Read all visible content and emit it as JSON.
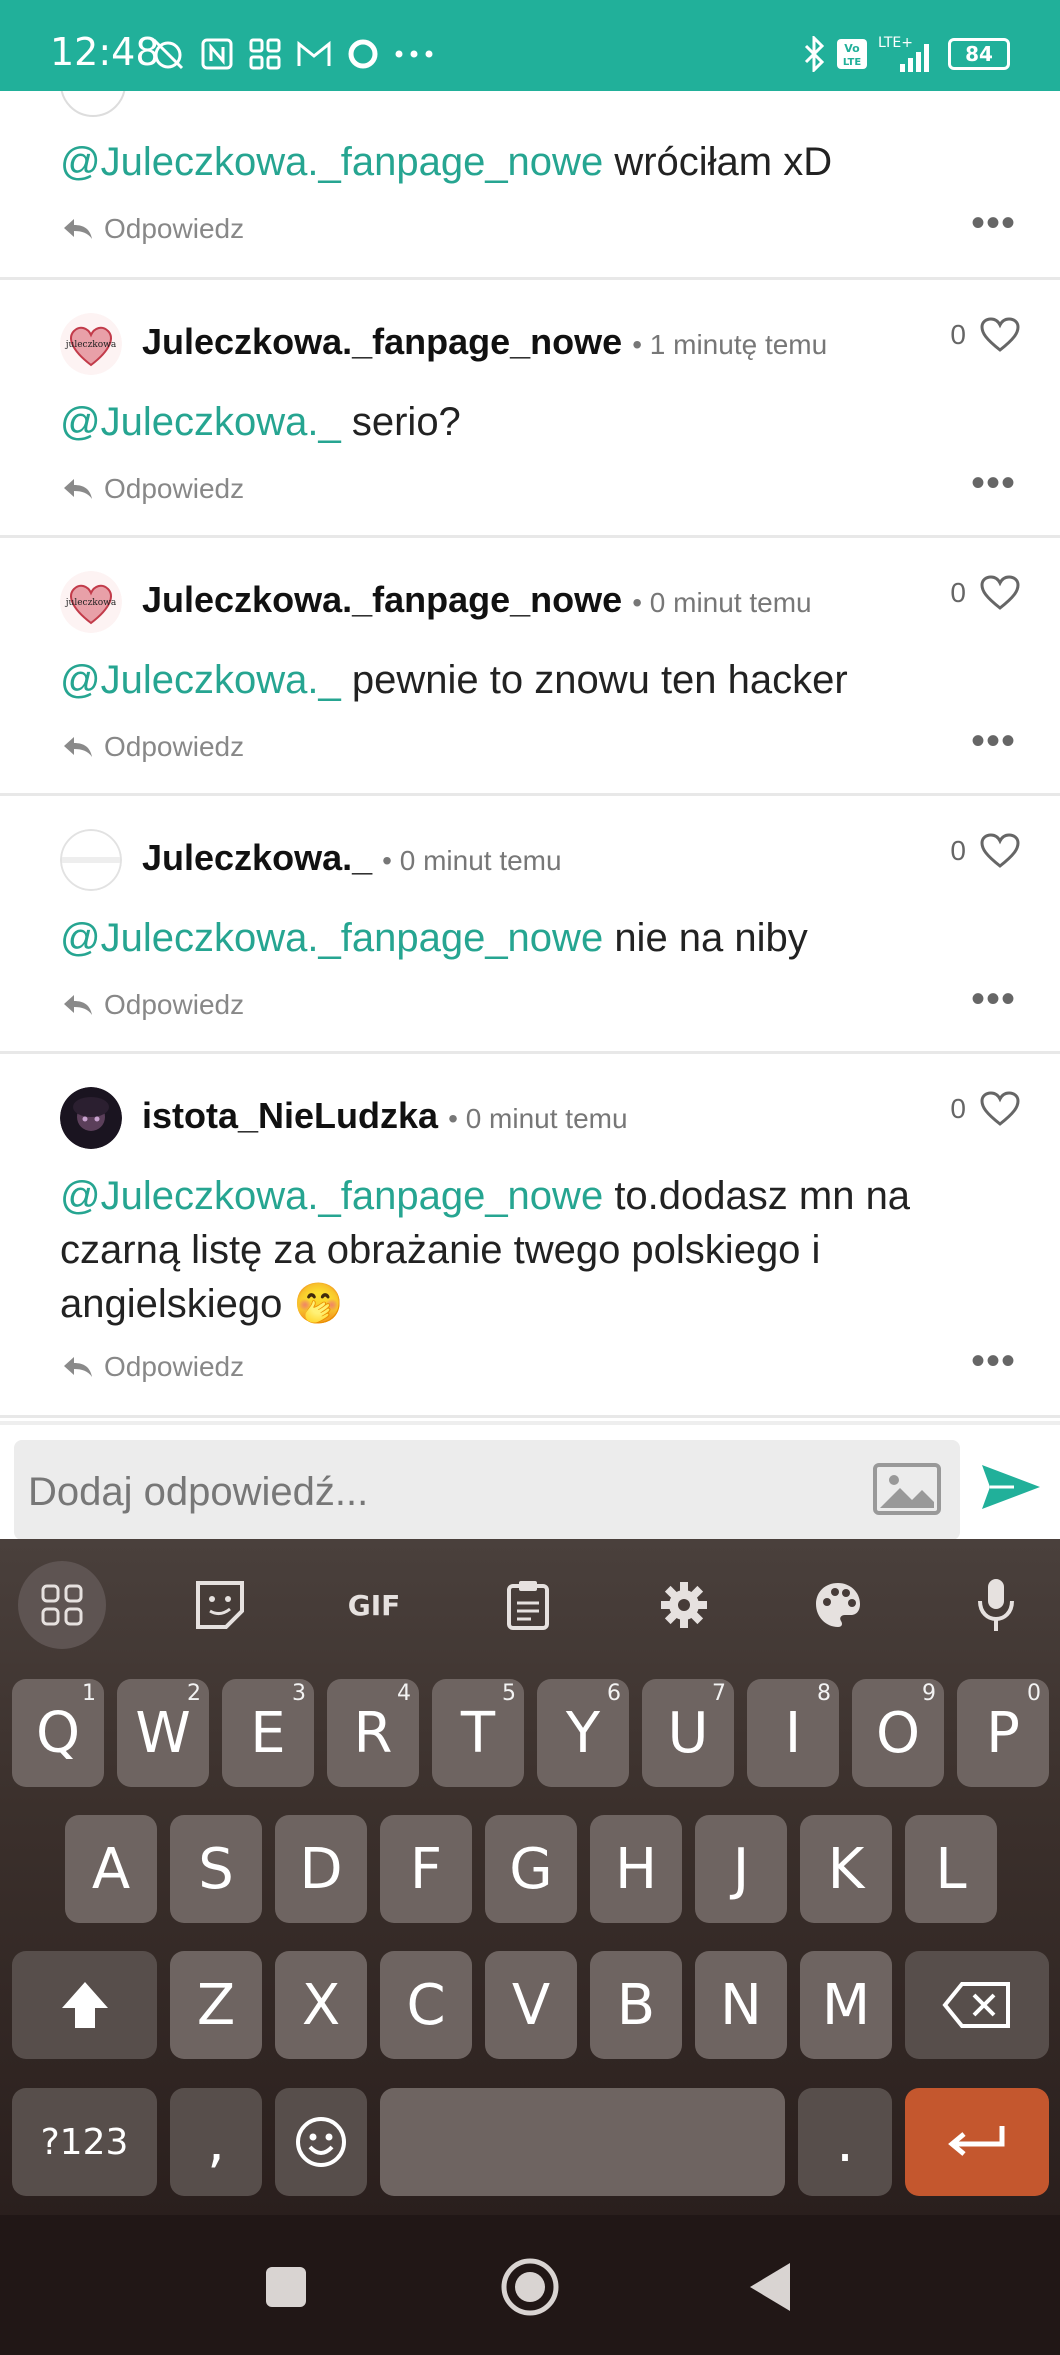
{
  "status_bar": {
    "time": "12:48",
    "battery": "84",
    "network": "LTE+",
    "volte": "Vo LTE"
  },
  "comments": [
    {
      "username": "",
      "time": "",
      "likes": "",
      "mention": "@Juleczkowa._fanpage_nowe",
      "text": "wróciłam xD",
      "reply_label": "Odpowiedz"
    },
    {
      "username": "Juleczkowa._fanpage_nowe",
      "time": "1 minutę temu",
      "likes": "0",
      "mention": "@Juleczkowa._",
      "text": "serio?",
      "reply_label": "Odpowiedz"
    },
    {
      "username": "Juleczkowa._fanpage_nowe",
      "time": "0 minut temu",
      "likes": "0",
      "mention": "@Juleczkowa._",
      "text": "pewnie to znowu ten hacker",
      "reply_label": "Odpowiedz"
    },
    {
      "username": "Juleczkowa._",
      "time": "0 minut temu",
      "likes": "0",
      "mention": "@Juleczkowa._fanpage_nowe",
      "text": "nie na niby",
      "reply_label": "Odpowiedz"
    },
    {
      "username": "istota_NieLudzka",
      "time": "0 minut temu",
      "likes": "0",
      "mention": "@Juleczkowa._fanpage_nowe",
      "text": "to.dodasz mn na czarną listę za obrażanie twego polskiego i angielskiego 🤭",
      "reply_label": "Odpowiedz"
    }
  ],
  "reply_input": {
    "placeholder": "Dodaj odpowiedź..."
  },
  "keyboard": {
    "toolbar": [
      "apps",
      "sticker",
      "GIF",
      "clipboard",
      "settings",
      "theme",
      "mic"
    ],
    "row1": [
      {
        "k": "Q",
        "h": "1"
      },
      {
        "k": "W",
        "h": "2"
      },
      {
        "k": "E",
        "h": "3"
      },
      {
        "k": "R",
        "h": "4"
      },
      {
        "k": "T",
        "h": "5"
      },
      {
        "k": "Y",
        "h": "6"
      },
      {
        "k": "U",
        "h": "7"
      },
      {
        "k": "I",
        "h": "8"
      },
      {
        "k": "O",
        "h": "9"
      },
      {
        "k": "P",
        "h": "0"
      }
    ],
    "row2": [
      "A",
      "S",
      "D",
      "F",
      "G",
      "H",
      "J",
      "K",
      "L"
    ],
    "row3": [
      "Z",
      "X",
      "C",
      "V",
      "B",
      "N",
      "M"
    ],
    "numbers_key": "?123",
    "comma_key": ",",
    "period_key": "."
  },
  "colors": {
    "accent": "#21b09a",
    "mention": "#26a591",
    "enter_key": "#c4572e"
  }
}
